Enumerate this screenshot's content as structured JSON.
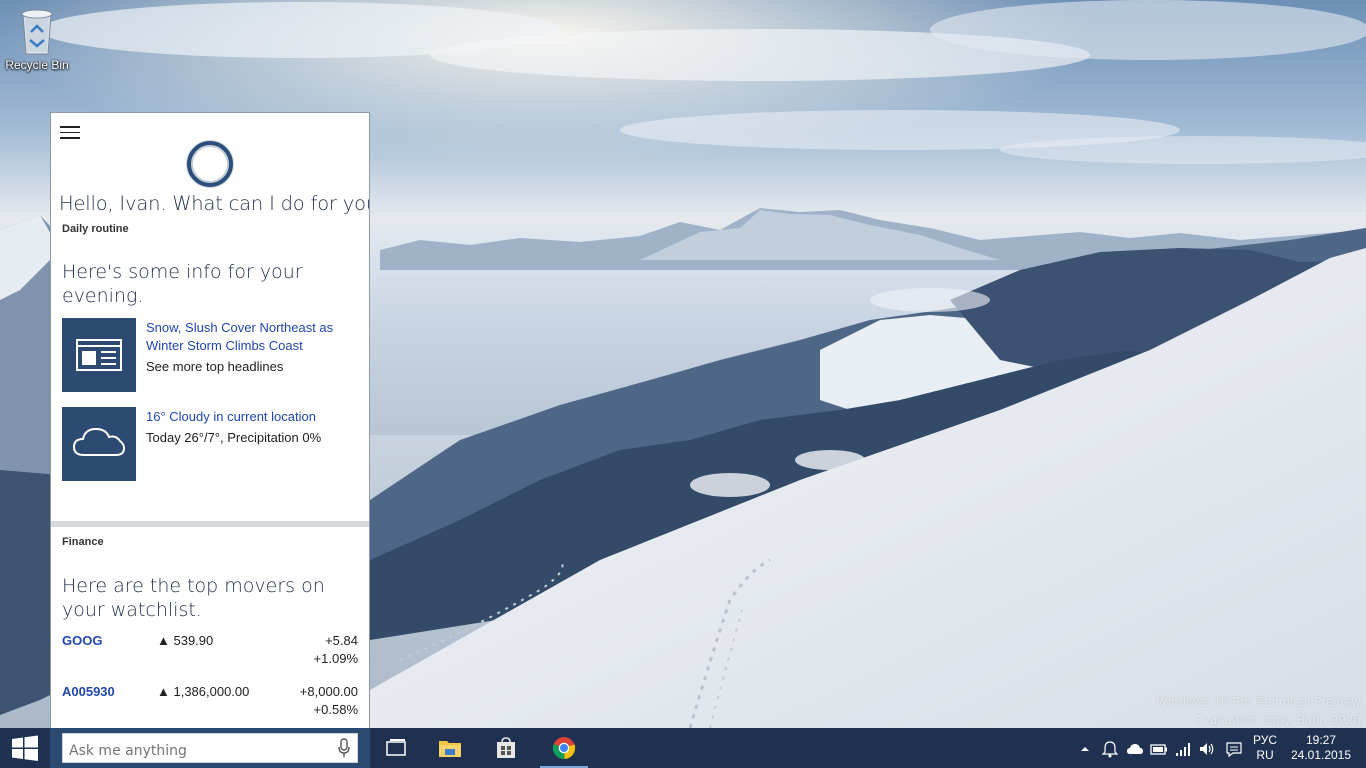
{
  "desktop": {
    "recycle_bin_label": "Recycle Bin",
    "watermark_line1": "Windows 10 Pro Technical Preview",
    "watermark_line2": "Evaluation copy. Build 9926"
  },
  "cortana": {
    "greeting": "Hello, Ivan. What can I do for you?",
    "daily_section": "Daily routine",
    "evening_heading": "Here's some info for your evening.",
    "news": {
      "icon": "newspaper-icon",
      "title": "Snow, Slush Cover Northeast as Winter Storm Climbs Coast",
      "subtitle": "See more top headlines"
    },
    "weather": {
      "icon": "cloud-icon",
      "title": "16° Cloudy in current location",
      "subtitle": "Today 26°/7°, Precipitation 0%"
    },
    "finance_section": "Finance",
    "finance_heading": "Here are the top movers on your watchlist.",
    "stocks": [
      {
        "symbol": "GOOG",
        "price": "▲ 539.90",
        "change_abs": "+5.84",
        "change_pct": "+1.09%"
      },
      {
        "symbol": "A005930",
        "price": "▲ 1,386,000.00",
        "change_abs": "+8,000.00",
        "change_pct": "+0.58%"
      }
    ],
    "accent_color": "#2c4a72",
    "link_color": "#2146b1"
  },
  "taskbar": {
    "search_placeholder": "Ask me anything",
    "apps": [
      "task-view-icon",
      "file-explorer-icon",
      "store-icon",
      "chrome-icon"
    ],
    "tray": {
      "lang_top": "РУС",
      "lang_bottom": "RU",
      "time": "19:27",
      "date": "24.01.2015"
    }
  }
}
